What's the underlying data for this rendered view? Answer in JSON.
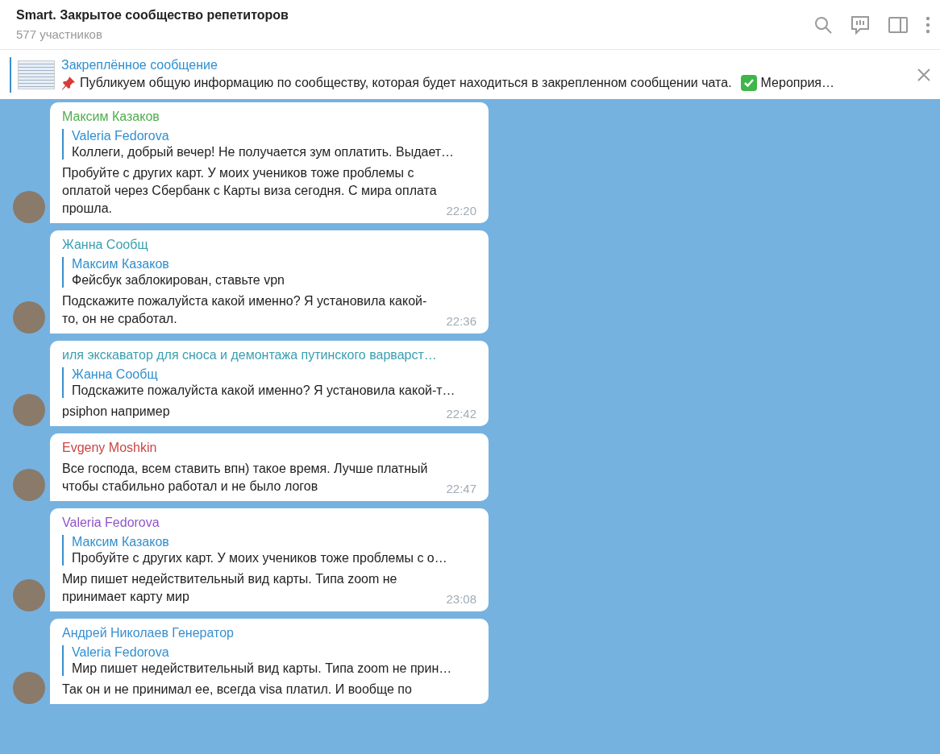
{
  "header": {
    "title": "Smart. Закрытое сообщество репетиторов",
    "subtitle": "577 участников"
  },
  "pinned": {
    "title": "Закреплённое сообщение",
    "text": "Публикуем общую информацию по сообществу, которая будет находиться в закрепленном сообщении чата.",
    "more": "Мероприя…"
  },
  "messages": [
    {
      "author": "Максим Казаков",
      "color": "#4fae4e",
      "reply": {
        "author": "Valeria Fedorova",
        "text": "Коллеги, добрый вечер!  Не получается зум оплатить. Выдает…"
      },
      "text": "Пробуйте с других карт. У моих учеников тоже проблемы с оплатой через Сбербанк с Карты виза сегодня. С мира оплата прошла.",
      "time": "22:20"
    },
    {
      "author": "Жанна Сообщ",
      "color": "#3a9fb0",
      "reply": {
        "author": "Максим Казаков",
        "text": "Фейсбук заблокирован, ставьте vpn"
      },
      "text": "Подскажите пожалуйста какой именно? Я установила какой-то, он не сработал.",
      "time": "22:36"
    },
    {
      "author": "иля экскаватор для сноса и демонтажа путинского варварст…",
      "color": "#3a9fb0",
      "reply": {
        "author": "Жанна Сообщ",
        "text": "Подскажите пожалуйста какой именно? Я установила какой-т…"
      },
      "text": "psiphon например",
      "time": "22:42"
    },
    {
      "author": "Evgeny Moshkin",
      "color": "#cc4444",
      "text": "Все господа, всем ставить впн) такое время. Лучше платный чтобы стабильно работал и не было логов",
      "time": "22:47"
    },
    {
      "author": "Valeria Fedorova",
      "color": "#8e55c9",
      "reply": {
        "author": "Максим Казаков",
        "text": "Пробуйте с других карт. У моих учеников тоже проблемы с о…"
      },
      "text": "Мир пишет недействительный вид карты. Типа zoom не принимает карту мир",
      "time": "23:08"
    },
    {
      "author": "Андрей Николаев Генератор",
      "color": "#3a8fd0",
      "reply": {
        "author": "Valeria Fedorova",
        "text": "Мир пишет недействительный вид карты. Типа zoom не прин…"
      },
      "text": "Так он и не принимал ее, всегда visa платил. И вообще по"
    }
  ]
}
